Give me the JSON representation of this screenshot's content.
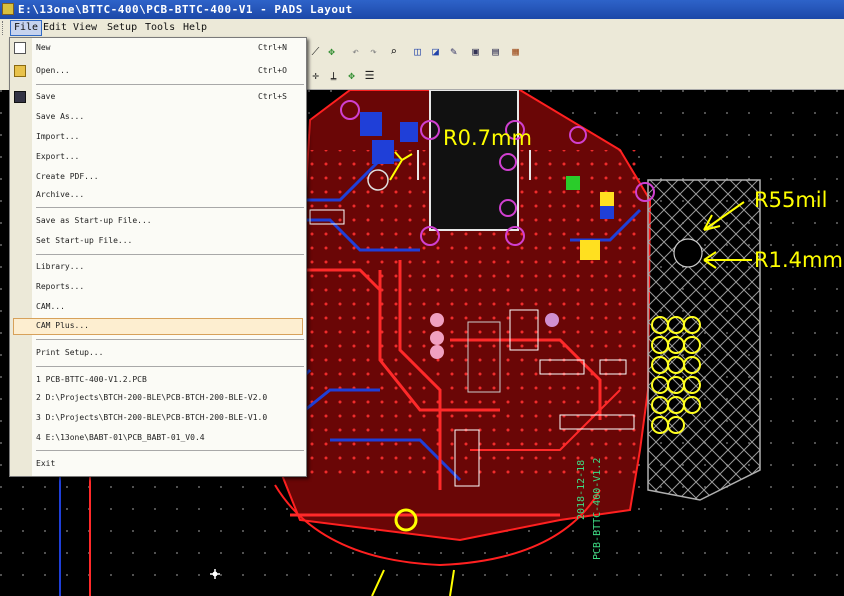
{
  "window": {
    "title": "E:\\13one\\BTTC-400\\PCB-BTTC-400-V1 - PADS Layout"
  },
  "menubar": [
    {
      "label": "File",
      "active": true
    },
    {
      "label": "Edit"
    },
    {
      "label": "View"
    },
    {
      "label": "Setup"
    },
    {
      "label": "Tools"
    },
    {
      "label": "Help"
    }
  ],
  "file_menu": {
    "items": [
      {
        "label": "New",
        "shortcut": "Ctrl+N",
        "icon": "new-file-icon"
      },
      {
        "label": "Open...",
        "shortcut": "Ctrl+O",
        "icon": "open-folder-icon"
      },
      {
        "label": "Save",
        "shortcut": "Ctrl+S",
        "icon": "save-disk-icon"
      },
      {
        "label": "Save As..."
      },
      {
        "label": "Import..."
      },
      {
        "label": "Export..."
      },
      {
        "label": "Create PDF..."
      },
      {
        "label": "Archive..."
      },
      {
        "label": "Save as Start-up File..."
      },
      {
        "label": "Set Start-up File..."
      },
      {
        "label": "Library..."
      },
      {
        "label": "Reports..."
      },
      {
        "label": "CAM..."
      },
      {
        "label": "CAM Plus...",
        "highlighted": true
      },
      {
        "label": "Print Setup..."
      },
      {
        "label": "1 PCB-BTTC-400-V1.2.PCB"
      },
      {
        "label": "2 D:\\Projects\\BTCH-200-BLE\\PCB-BTCH-200-BLE-V2.0"
      },
      {
        "label": "3 D:\\Projects\\BTCH-200-BLE\\PCB-BTCH-200-BLE-V1.0"
      },
      {
        "label": "4 E:\\13one\\BABT-01\\PCB_BABT-01_V0.4"
      },
      {
        "label": "Exit"
      }
    ]
  },
  "annotations": {
    "radius_top": "R0.7mm",
    "r55": "R55mil",
    "r14": "R1.4mm",
    "board_label": "PCB-BTTC-400-V1.2",
    "board_date": "2018-12-18"
  },
  "colors": {
    "titlebar": "#1c48a8",
    "menu_bg": "#ece9d8",
    "highlight": "#fdeed0",
    "trace_red": "#e01010",
    "trace_blue": "#1f3fd8",
    "annotation_yellow": "#ffff00",
    "pad_magenta": "#d040d0"
  }
}
